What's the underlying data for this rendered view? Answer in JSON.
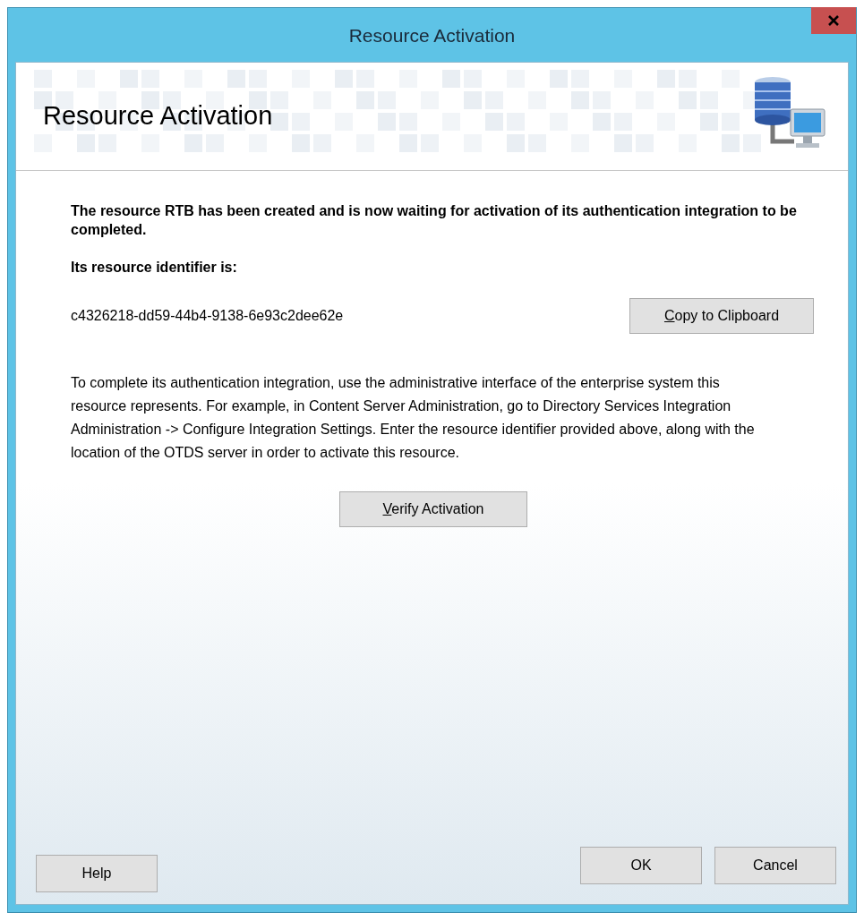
{
  "window": {
    "title": "Resource Activation"
  },
  "header": {
    "title": "Resource Activation"
  },
  "message": "The resource RTB has been created and is now waiting for activation of its authentication integration to be completed.",
  "identifier_label": "Its resource identifier is:",
  "identifier": "c4326218-dd59-44b4-9138-6e93c2dee62e",
  "copy_button": {
    "label": "Copy to Clipboard",
    "access_key": true
  },
  "instructions": "To complete its authentication integration, use the administrative interface of the enterprise system this resource represents. For example, in Content Server Administration, go to Directory Services Integration Administration -> Configure Integration Settings. Enter the resource identifier provided above, along with the location of the OTDS server in order to activate this resource.",
  "verify_button": {
    "label": "Verify Activation",
    "access_key": true
  },
  "buttons": [
    {
      "label": "Help",
      "kind": "help"
    },
    {
      "label": "OK",
      "kind": "confirm"
    },
    {
      "label": "Cancel",
      "kind": "cancel"
    }
  ]
}
